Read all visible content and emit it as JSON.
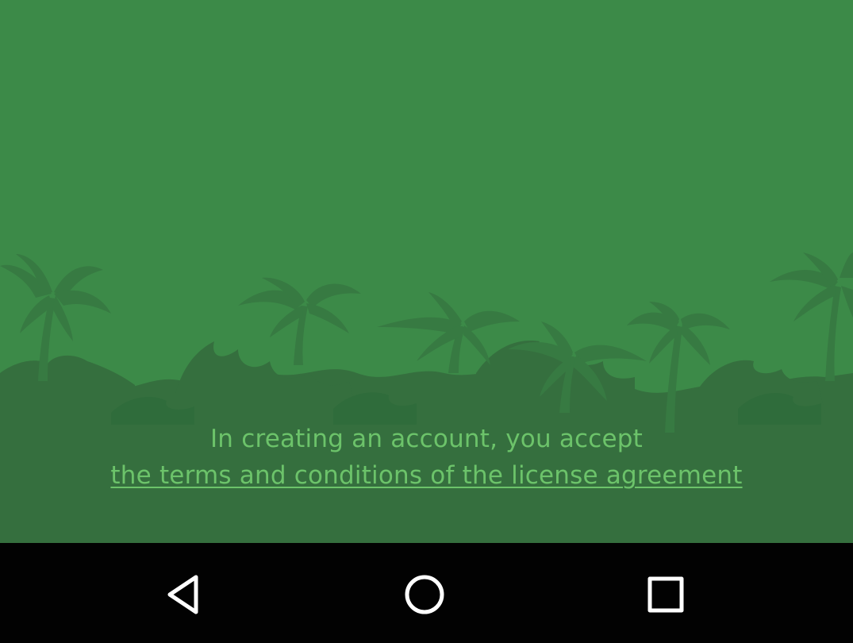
{
  "colors": {
    "background": "#3c8a48",
    "silhouette": "#34733f",
    "ground": "#336f3e",
    "text": "#6cc36a",
    "navbar": "#020202",
    "nav_icon": "#ffffff"
  },
  "terms": {
    "intro": "In creating an account, you accept",
    "link": "the terms and conditions of the license agreement"
  },
  "navbar": {
    "back_icon": "triangle-back-icon",
    "home_icon": "circle-home-icon",
    "recents_icon": "square-recents-icon"
  }
}
